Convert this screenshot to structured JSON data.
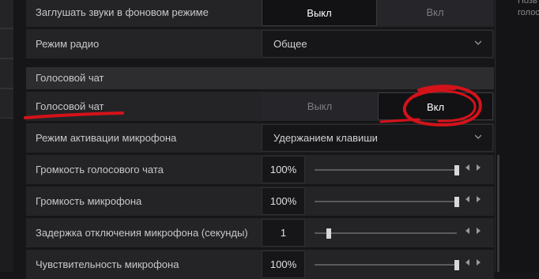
{
  "right_panel": {
    "text_lines": [
      "Позв",
      "голос"
    ]
  },
  "settings": {
    "mute_background": {
      "label": "Заглушать звуки в фоновом режиме",
      "options": [
        "Выкл",
        "Вкл"
      ],
      "selected": "Выкл"
    },
    "radio_mode": {
      "label": "Режим радио",
      "value": "Общее"
    },
    "voice_section": {
      "title": "Голосовой чат"
    },
    "voice_chat": {
      "label": "Голосовой чат",
      "options": [
        "Выкл",
        "Вкл"
      ],
      "selected": "Вкл"
    },
    "mic_activation": {
      "label": "Режим активации микрофона",
      "value": "Удержанием клавиши"
    },
    "voice_volume": {
      "label": "Громкость голосового чата",
      "display": "100%",
      "level": 1.0
    },
    "mic_volume": {
      "label": "Громкость микрофона",
      "display": "100%",
      "level": 1.0
    },
    "mic_delay": {
      "label": "Задержка отключения микрофона (секунды)",
      "display": "1",
      "level": 0.1
    },
    "mic_sensitivity": {
      "label": "Чувствительность микрофона",
      "display": "100%",
      "level": 1.0
    }
  },
  "annotation_color": "#d4121a"
}
